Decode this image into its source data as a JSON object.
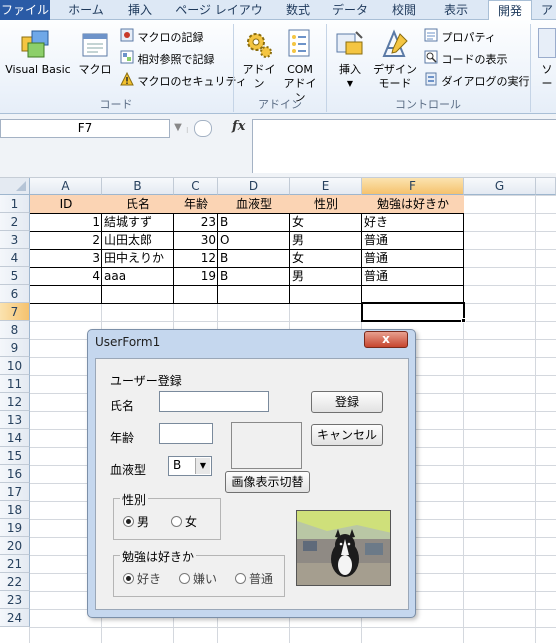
{
  "ribbon": {
    "tabs": [
      "ファイル",
      "ホーム",
      "挿入",
      "ページ レイアウト",
      "数式",
      "データ",
      "校閲",
      "表示",
      "開発",
      "ア"
    ],
    "active_tab": "開発",
    "code_group": {
      "label": "コード",
      "visual_basic": "Visual Basic",
      "macro": "マクロ",
      "record_macro": "マクロの記録",
      "relative_ref": "相対参照で記録",
      "macro_security": "マクロのセキュリティ"
    },
    "addin_group": {
      "label": "アドイン",
      "addin": "アドイン",
      "com_addin_1": "COM",
      "com_addin_2": "アドイン"
    },
    "control_group": {
      "label": "コントロール",
      "insert": "挿入",
      "design_mode_1": "デザイン",
      "design_mode_2": "モード",
      "properties": "プロパティ",
      "view_code": "コードの表示",
      "run_dialog": "ダイアログの実行"
    },
    "xml_partial": "ソー"
  },
  "formula_bar": {
    "name_box": "F7",
    "fx": "fx",
    "content": ""
  },
  "sheet": {
    "columns": [
      "A",
      "B",
      "C",
      "D",
      "E",
      "F",
      "G"
    ],
    "selected_column": "F",
    "selected_row": "7",
    "row_numbers": [
      "1",
      "2",
      "3",
      "4",
      "5",
      "6",
      "7",
      "8",
      "9",
      "10",
      "11",
      "12",
      "13",
      "14",
      "15",
      "16",
      "17",
      "18",
      "19",
      "20",
      "21",
      "22",
      "23",
      "24"
    ],
    "header": [
      "ID",
      "氏名",
      "年齢",
      "血液型",
      "性別",
      "勉強は好きか"
    ],
    "rows": [
      [
        "1",
        "結城すず",
        "23",
        "B",
        "女",
        "好き"
      ],
      [
        "2",
        "山田太郎",
        "30",
        "O",
        "男",
        "普通"
      ],
      [
        "3",
        "田中えりか",
        "12",
        "B",
        "女",
        "普通"
      ],
      [
        "4",
        "aaa",
        "19",
        "B",
        "男",
        "普通"
      ]
    ]
  },
  "userform": {
    "title": "UserForm1",
    "close": "x",
    "heading": "ユーザー登録",
    "name_label": "氏名",
    "name_value": "",
    "age_label": "年齢",
    "age_value": "",
    "blood_label": "血液型",
    "blood_value": "B",
    "register_button": "登録",
    "cancel_button": "キャンセル",
    "toggle_image_button": "画像表示切替",
    "gender_frame": "性別",
    "gender_options": [
      "男",
      "女"
    ],
    "gender_selected": "男",
    "study_frame": "勉強は好きか",
    "study_options": [
      "好き",
      "嫌い",
      "普通"
    ],
    "study_selected": "好き"
  }
}
